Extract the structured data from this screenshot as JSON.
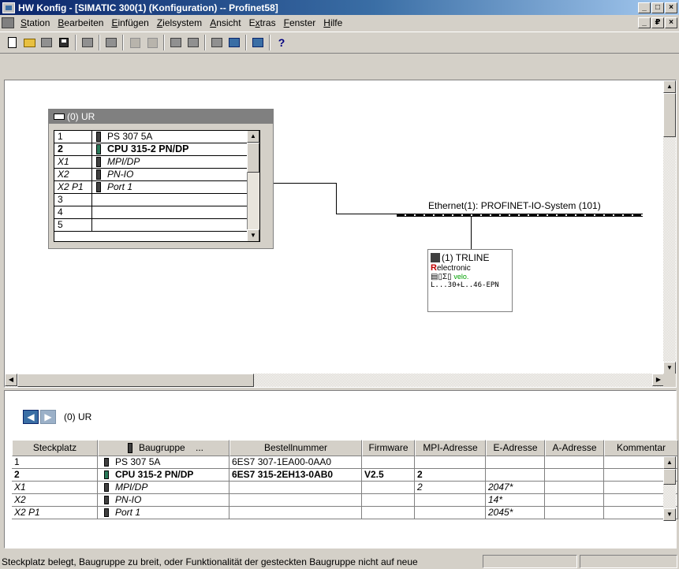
{
  "window": {
    "title": "HW Konfig - [SIMATIC 300(1) (Konfiguration) -- Profinet58]",
    "min": "_",
    "max": "□",
    "close": "×",
    "restore": "₽"
  },
  "menu": {
    "items": [
      {
        "label": "Station",
        "accel": "S",
        "rest": "tation"
      },
      {
        "label": "Bearbeiten",
        "accel": "B",
        "rest": "earbeiten"
      },
      {
        "label": "Einfügen",
        "accel": "E",
        "rest": "infügen"
      },
      {
        "label": "Zielsystem",
        "accel": "Z",
        "rest": "ielsystem"
      },
      {
        "label": "Ansicht",
        "accel": "A",
        "rest": "nsicht"
      },
      {
        "label": "Extras",
        "accel": "x",
        "pre": "E",
        "rest": "tras"
      },
      {
        "label": "Fenster",
        "accel": "F",
        "rest": "enster"
      },
      {
        "label": "Hilfe",
        "accel": "H",
        "rest": "ilfe"
      }
    ]
  },
  "toolbar": {
    "icons": [
      "new-icon",
      "open-icon",
      "network-icon",
      "save-icon",
      "compile-icon",
      "print-icon",
      "copy-icon",
      "paste-icon",
      "download-icon",
      "upload-icon",
      "catalog-icon",
      "config-icon",
      "netpro-icon",
      "help-icon"
    ],
    "help_glyph": "?"
  },
  "rack": {
    "title": "(0) UR",
    "rows": [
      {
        "slot": "1",
        "module": "PS 307 5A",
        "style": "normal",
        "icon": "ps"
      },
      {
        "slot": "2",
        "module": "CPU 315-2 PN/DP",
        "style": "bold",
        "icon": "cpu"
      },
      {
        "slot": "X1",
        "module": "MPI/DP",
        "style": "ital",
        "icon": "sub"
      },
      {
        "slot": "X2",
        "module": "PN-IO",
        "style": "ital",
        "icon": "sub"
      },
      {
        "slot": "X2 P1",
        "module": "Port 1",
        "style": "ital",
        "icon": "sub"
      },
      {
        "slot": "3",
        "module": "",
        "style": "normal",
        "icon": ""
      },
      {
        "slot": "4",
        "module": "",
        "style": "normal",
        "icon": ""
      },
      {
        "slot": "5",
        "module": "",
        "style": "normal",
        "icon": ""
      }
    ]
  },
  "network": {
    "label": "Ethernet(1): PROFINET-IO-System (101)"
  },
  "device": {
    "title": "(1) TRLINE",
    "brand_r": "R",
    "brand_rest": "electronic",
    "glyphs": "▤▯Σ▯",
    "velo": "velo.",
    "part": "L...30+L..46-EPN"
  },
  "detail": {
    "nav_label": "(0)  UR",
    "left_arrow": "◀",
    "right_arrow": "▶",
    "headers": [
      "Steckplatz",
      "Baugruppe",
      "...",
      "Bestellnummer",
      "Firmware",
      "MPI-Adresse",
      "E-Adresse",
      "A-Adresse",
      "Kommentar"
    ],
    "rows": [
      {
        "slot": "1",
        "module": "PS 307 5A",
        "order": "6ES7 307-1EA00-0AA0",
        "fw": "",
        "mpi": "",
        "e": "",
        "a": "",
        "comment": "",
        "style": "normal"
      },
      {
        "slot": "2",
        "module": "CPU 315-2 PN/DP",
        "order": "6ES7 315-2EH13-0AB0",
        "fw": "V2.5",
        "mpi": "2",
        "e": "",
        "a": "",
        "comment": "",
        "style": "bold"
      },
      {
        "slot": "X1",
        "module": "MPI/DP",
        "order": "",
        "fw": "",
        "mpi": "2",
        "e": "2047*",
        "a": "",
        "comment": "",
        "style": "ital"
      },
      {
        "slot": "X2",
        "module": "PN-IO",
        "order": "",
        "fw": "",
        "mpi": "",
        "e": "14*",
        "a": "",
        "comment": "",
        "style": "ital"
      },
      {
        "slot": "X2 P1",
        "module": "Port 1",
        "order": "",
        "fw": "",
        "mpi": "",
        "e": "2045*",
        "a": "",
        "comment": "",
        "style": "ital"
      }
    ]
  },
  "status": {
    "text": "Steckplatz belegt, Baugruppe zu breit, oder Funktionalität der gesteckten Baugruppe nicht auf  neue"
  }
}
